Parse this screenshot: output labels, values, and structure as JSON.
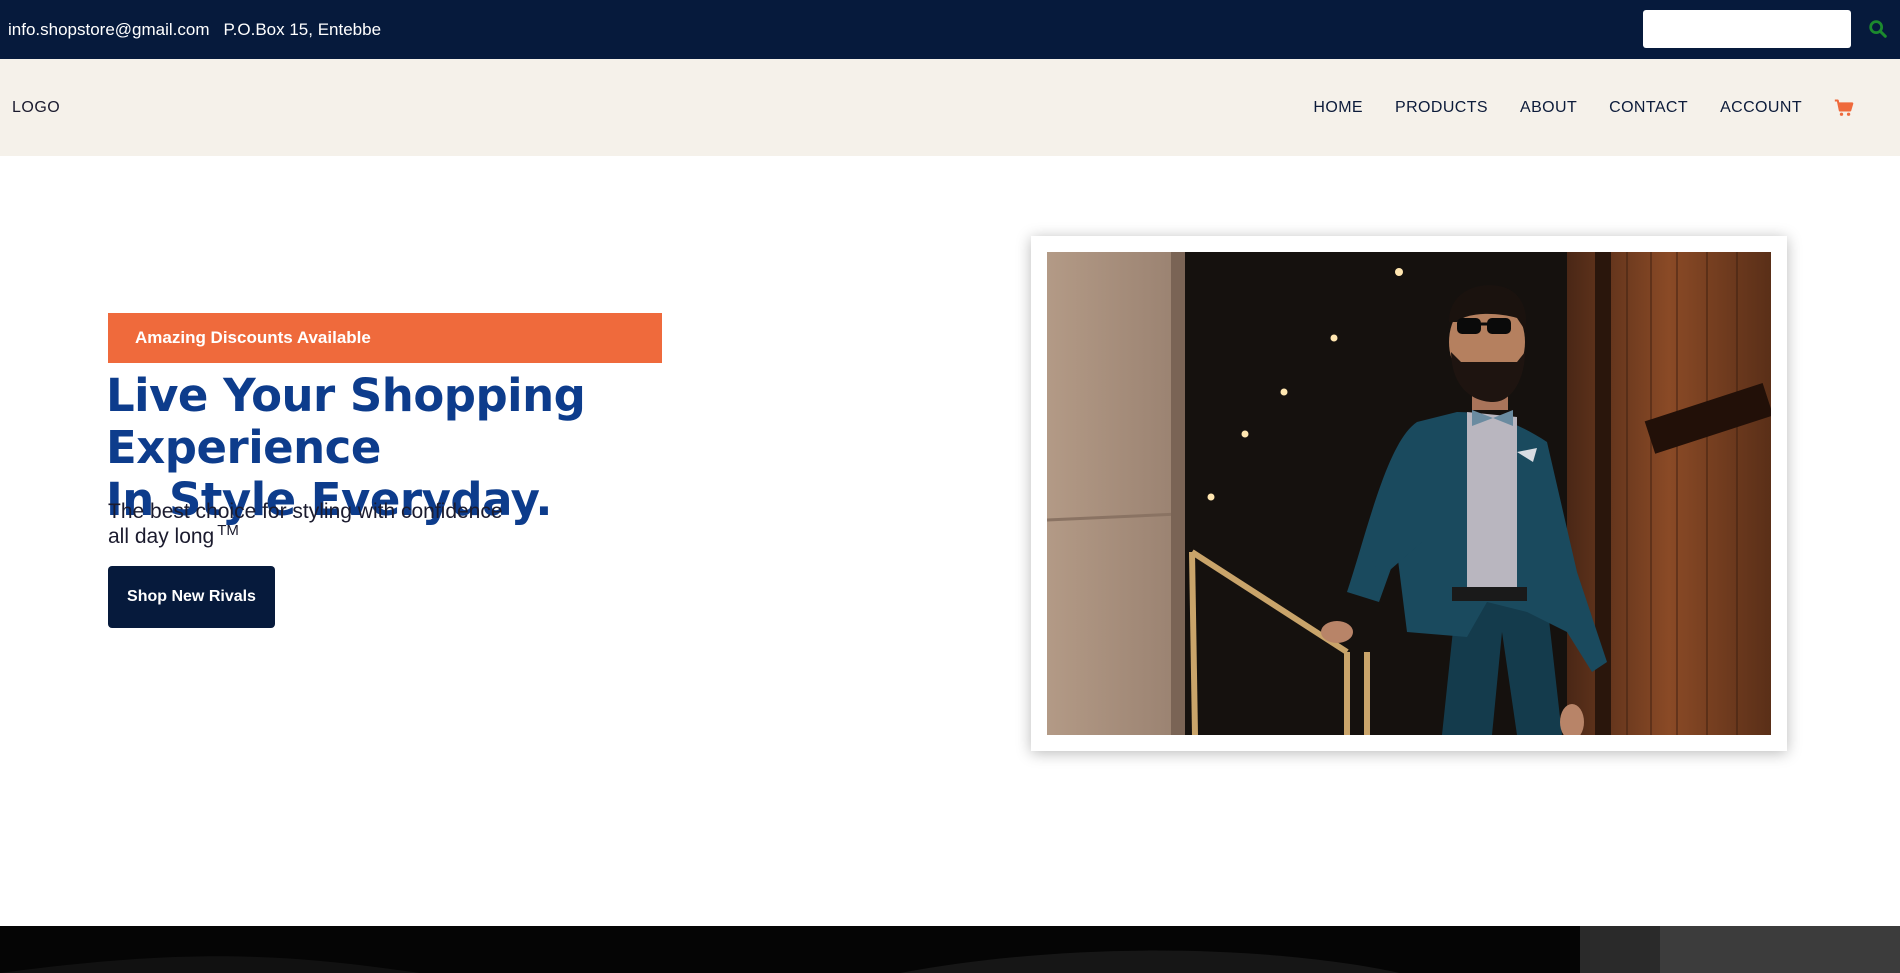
{
  "topbar": {
    "email": "info.shopstore@gmail.com",
    "address": "P.O.Box 15, Entebbe",
    "search_placeholder": "",
    "search_icon": "search-icon"
  },
  "nav": {
    "logo": "LOGO",
    "links": [
      "HOME",
      "PRODUCTS",
      "ABOUT",
      "CONTACT",
      "ACCOUNT"
    ],
    "cart_icon": "cart-icon"
  },
  "hero": {
    "badge": "Amazing Discounts Available",
    "headline_line1": "Live Your Shopping Experience",
    "headline_line2": "In Style Everyday.",
    "subtext_line1": "The best choice for styling with confidence",
    "subtext_line2": "all day long",
    "trademark": "TM",
    "cta_label": "Shop New Rivals"
  },
  "colors": {
    "topbar": "#061a3c",
    "nav_bg": "#f5f1ea",
    "accent_orange": "#ef6a3c",
    "headline_blue": "#0d3c8c",
    "search_icon_green": "#1c8a2e"
  }
}
